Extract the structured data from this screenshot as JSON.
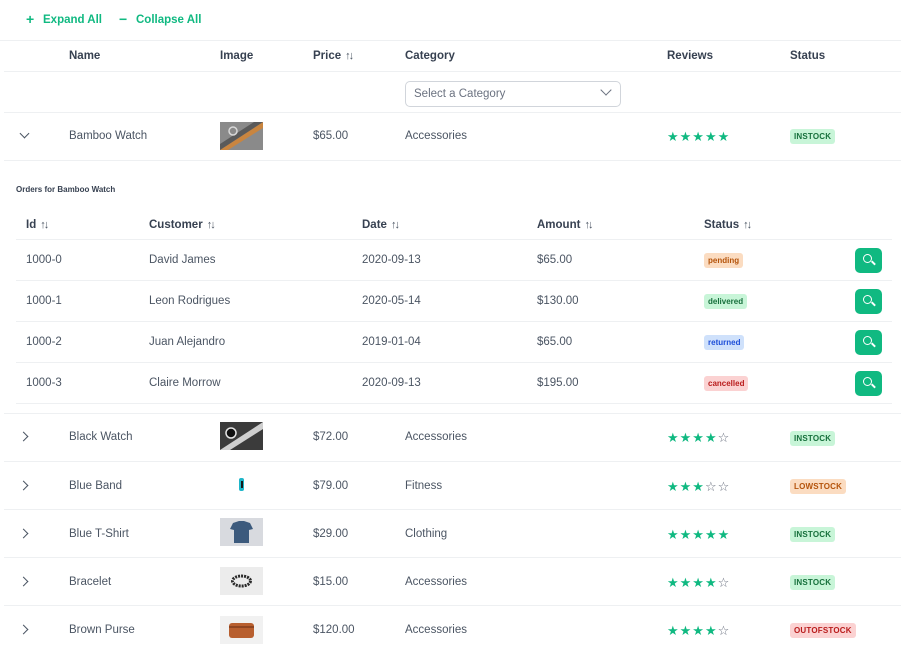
{
  "toolbar": {
    "expand_all": "Expand All",
    "collapse_all": "Collapse All"
  },
  "columns": {
    "name": "Name",
    "image": "Image",
    "price": "Price",
    "category": "Category",
    "reviews": "Reviews",
    "status": "Status"
  },
  "category_filter": {
    "placeholder": "Select a Category"
  },
  "products": [
    {
      "name": "Bamboo Watch",
      "price": "$65.00",
      "category": "Accessories",
      "rating": 5,
      "status": "INSTOCK",
      "expanded": true
    },
    {
      "name": "Black Watch",
      "price": "$72.00",
      "category": "Accessories",
      "rating": 4,
      "status": "INSTOCK"
    },
    {
      "name": "Blue Band",
      "price": "$79.00",
      "category": "Fitness",
      "rating": 3,
      "status": "LOWSTOCK"
    },
    {
      "name": "Blue T-Shirt",
      "price": "$29.00",
      "category": "Clothing",
      "rating": 5,
      "status": "INSTOCK"
    },
    {
      "name": "Bracelet",
      "price": "$15.00",
      "category": "Accessories",
      "rating": 4,
      "status": "INSTOCK"
    },
    {
      "name": "Brown Purse",
      "price": "$120.00",
      "category": "Accessories",
      "rating": 4,
      "status": "OUTOFSTOCK"
    }
  ],
  "orders": {
    "title": "Orders for Bamboo Watch",
    "columns": {
      "id": "Id",
      "customer": "Customer",
      "date": "Date",
      "amount": "Amount",
      "status": "Status"
    },
    "rows": [
      {
        "id": "1000-0",
        "customer": "David James",
        "date": "2020-09-13",
        "amount": "$65.00",
        "status": "pending"
      },
      {
        "id": "1000-1",
        "customer": "Leon Rodrigues",
        "date": "2020-05-14",
        "amount": "$130.00",
        "status": "delivered"
      },
      {
        "id": "1000-2",
        "customer": "Juan Alejandro",
        "date": "2019-01-04",
        "amount": "$65.00",
        "status": "returned"
      },
      {
        "id": "1000-3",
        "customer": "Claire Morrow",
        "date": "2020-09-13",
        "amount": "$195.00",
        "status": "cancelled"
      }
    ]
  },
  "icons": {
    "expand": "plus-icon",
    "collapse": "minus-icon",
    "sort": "sort-icon",
    "row_collapsed": "chevron-right-icon",
    "row_expanded": "chevron-down-icon",
    "dropdown": "chevron-down-icon",
    "search": "search-icon",
    "star": "star-icon"
  },
  "colors": {
    "accent": "#10b981",
    "instock_bg": "#c8f5d8",
    "lowstock_bg": "#fbdcc1",
    "outofstock_bg": "#fbd2d2",
    "returned_bg": "#cfe1fb"
  }
}
